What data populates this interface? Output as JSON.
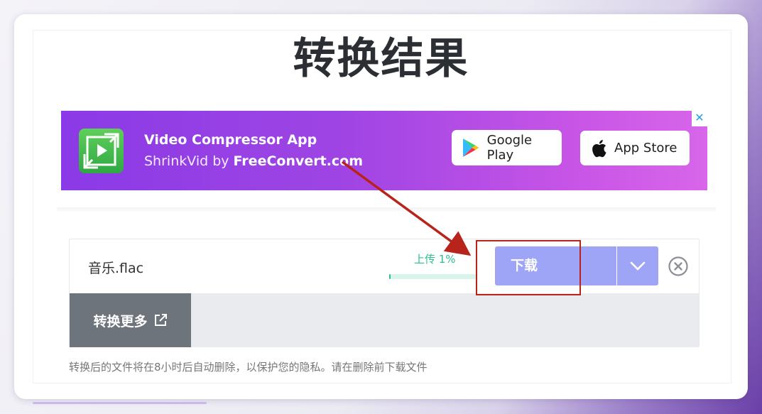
{
  "page": {
    "title": "转换结果"
  },
  "ad": {
    "title": "Video Compressor App",
    "subtitle_prefix": "ShrinkVid by ",
    "subtitle_brand": "FreeConvert.com",
    "google_play": "Google Play",
    "app_store": "App Store",
    "close": "✕"
  },
  "file": {
    "name": "音乐.flac",
    "progress_label": "上传 1%",
    "progress_percent": 1,
    "download_label": "下载",
    "convert_more_label": "转换更多"
  },
  "note": "转换后的文件将在8小时后自动删除，以保护您的隐私。请在删除前下载文件",
  "colors": {
    "accent": "#9ea5f7",
    "progress": "#2cc08a",
    "annotation": "#b8241c"
  }
}
